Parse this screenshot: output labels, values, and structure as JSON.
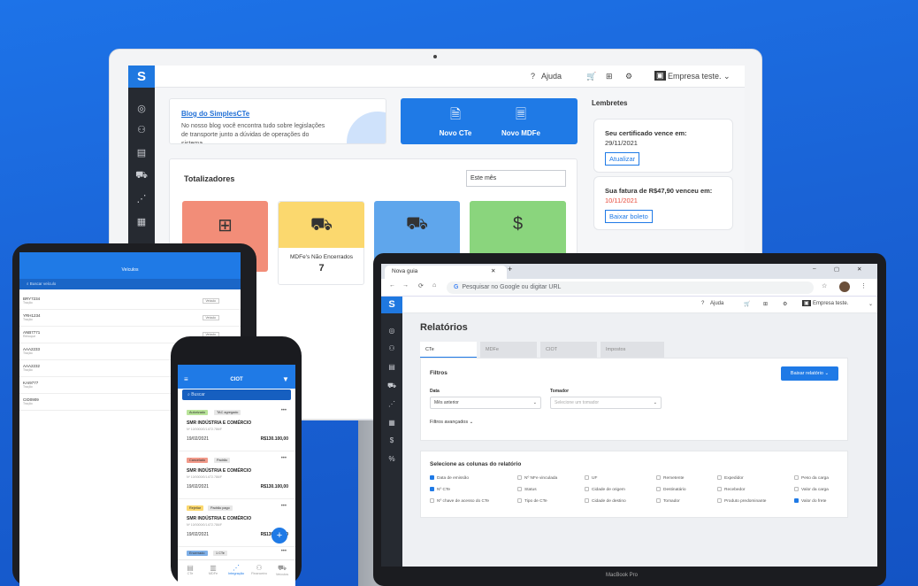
{
  "monitor": {
    "topbar": {
      "help": "Ajuda",
      "company": "Empresa teste."
    },
    "blog": {
      "title": "Blog do SimplesCTe",
      "text": "No nosso blog você encontra tudo sobre legislações de transporte junto a dúvidas de operações do sistema."
    },
    "actions": {
      "cte": "Novo CTe",
      "mdfe": "Novo MDFe"
    },
    "totalizers": {
      "title": "Totalizadores",
      "period": "Este mês",
      "tile_label": "MDFe's Não Encerrados",
      "tile_value": "7"
    },
    "reminders": {
      "title": "Lembretes",
      "cert_title": "Seu certificado vence em:",
      "cert_date": "29/11/2021",
      "cert_button": "Atualizar",
      "invoice_title": "Sua fatura de R$47,90 venceu em:",
      "invoice_date": "10/11/2021",
      "invoice_button": "Baixar boleto"
    }
  },
  "tablet": {
    "title": "Veículos",
    "search": "Buscar veículo",
    "rows": [
      {
        "plate": "BRY7234",
        "sub": "Tração",
        "badge": "Veículo"
      },
      {
        "plate": "YRH1234",
        "sub": "Tração",
        "badge": "Veículo"
      },
      {
        "plate": "ANB7771",
        "sub": "Reboque",
        "badge": "Veículo"
      },
      {
        "plate": "AAA2233",
        "sub": "Tração",
        "badge": ""
      },
      {
        "plate": "AAA2232",
        "sub": "Tração",
        "badge": ""
      },
      {
        "plate": "KAI9777",
        "sub": "Tração",
        "badge": ""
      },
      {
        "plate": "CID0909",
        "sub": "Tração",
        "badge": ""
      }
    ]
  },
  "phone": {
    "title": "CIOT",
    "search": "Buscar",
    "cards": [
      {
        "tag1": "Autorizado",
        "tag2": "TAC agregado",
        "name": "SMR INDÚSTRIA E COMÉRCIO",
        "num": "Nº 10/0000/0/1.672.786/F",
        "date": "19/02/2021",
        "value": "R$130.100,00"
      },
      {
        "tag1": "Cancelado",
        "tag2": "Padrão",
        "name": "SMR INDÚSTRIA E COMÉRCIO",
        "num": "Nº 10/0000/0/1.672.786/F",
        "date": "19/02/2021",
        "value": "R$130.100,00"
      },
      {
        "tag1": "Rejeitar",
        "tag2": "Padrão pago",
        "name": "SMR INDÚSTRIA E COMÉRCIO",
        "num": "Nº 10/0000/0/1.672.786/F",
        "date": "19/02/2021",
        "value": "R$130.100,00"
      },
      {
        "tag1": "Encerrado",
        "tag2": "1 CTe",
        "name": "",
        "num": "",
        "date": "",
        "value": ""
      }
    ],
    "nav": [
      "CTe",
      "MDFe",
      "Integração",
      "Financeiro",
      "Veículos"
    ]
  },
  "laptop": {
    "tab_label": "Nova guia",
    "omnibox": "Pesquisar no Google ou digitar URL",
    "topbar": {
      "help": "Ajuda",
      "company": "Empresa teste."
    },
    "title": "Relatórios",
    "tabs": [
      "CTe",
      "MDFe",
      "CIOT",
      "Impostos"
    ],
    "filters": {
      "title": "Filtros",
      "download": "Baixar relatório",
      "date_label": "Data",
      "date_value": "Mês anterior",
      "taker_label": "Tomador",
      "taker_placeholder": "Selecione um tomador",
      "advanced": "Filtros avançados"
    },
    "columns": {
      "title": "Selecione as colunas do relatório",
      "items": [
        {
          "label": "Data de emissão",
          "checked": true
        },
        {
          "label": "Nº NFe vinculada",
          "checked": false
        },
        {
          "label": "UF",
          "checked": false
        },
        {
          "label": "Remetente",
          "checked": false
        },
        {
          "label": "Expedidor",
          "checked": false
        },
        {
          "label": "Peso da carga",
          "checked": false
        },
        {
          "label": "Nº CTe",
          "checked": true
        },
        {
          "label": "Status",
          "checked": false
        },
        {
          "label": "Cidade de origem",
          "checked": false
        },
        {
          "label": "Destinatário",
          "checked": false
        },
        {
          "label": "Recebedor",
          "checked": false
        },
        {
          "label": "Valor da carga",
          "checked": false
        },
        {
          "label": "Nº chave de acesso do CTe",
          "checked": false
        },
        {
          "label": "Tipo de CTe",
          "checked": false
        },
        {
          "label": "Cidade de destino",
          "checked": false
        },
        {
          "label": "Tomador",
          "checked": false
        },
        {
          "label": "Produto predominante",
          "checked": false
        },
        {
          "label": "Valor do frete",
          "checked": true
        }
      ]
    },
    "brand": "MacBook Pro"
  },
  "colors": {
    "background": "#1a63d6",
    "accent": "#1f7ae6",
    "sidebar": "#262a31",
    "tile_orange": "#f28d78",
    "tile_yellow": "#fbd86e",
    "tile_blue": "#5fa6ec",
    "tile_green": "#8ad57d",
    "alert_red": "#e74c3c"
  }
}
